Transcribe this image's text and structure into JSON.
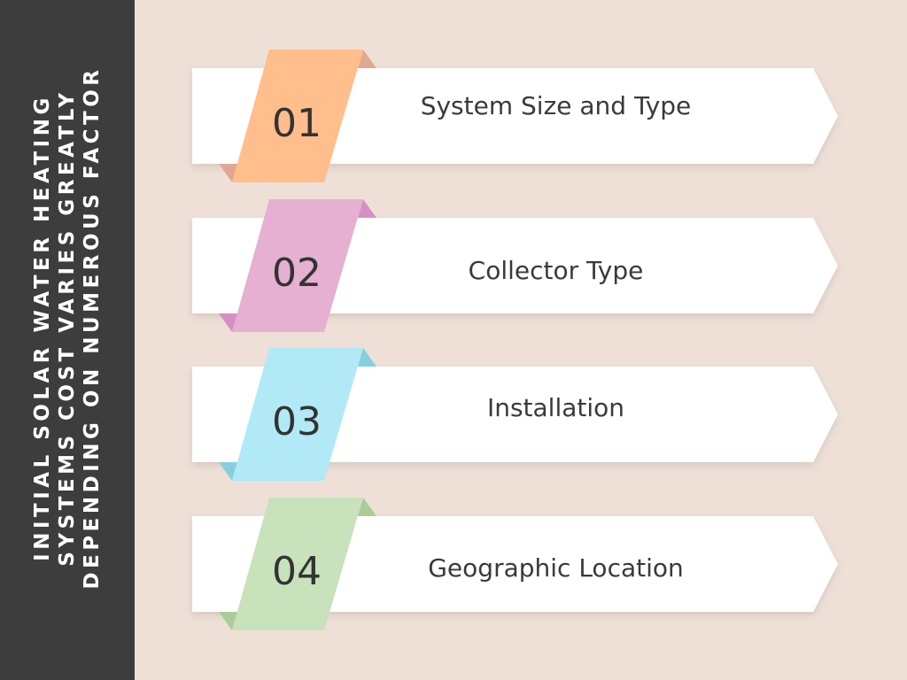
{
  "title": "INITIAL SOLAR WATER HEATING SYSTEMS COST VARIES GREATLY DEPENDING ON NUMEROUS FACTOR",
  "colors": {
    "background": "#eee0d6",
    "sidebar": "#3d3d3d",
    "banner": "#ffffff"
  },
  "steps": [
    {
      "number": "01",
      "label": "System Size and Type",
      "color": "#ffbe8c",
      "fold": "#e0a894"
    },
    {
      "number": "02",
      "label": "Collector Type",
      "color": "#e5b0d2",
      "fold": "#d590c3"
    },
    {
      "number": "03",
      "label": "Installation",
      "color": "#b1e9f6",
      "fold": "#88cfde"
    },
    {
      "number": "04",
      "label": "Geographic Location",
      "color": "#c8e2bc",
      "fold": "#aacd98"
    }
  ]
}
